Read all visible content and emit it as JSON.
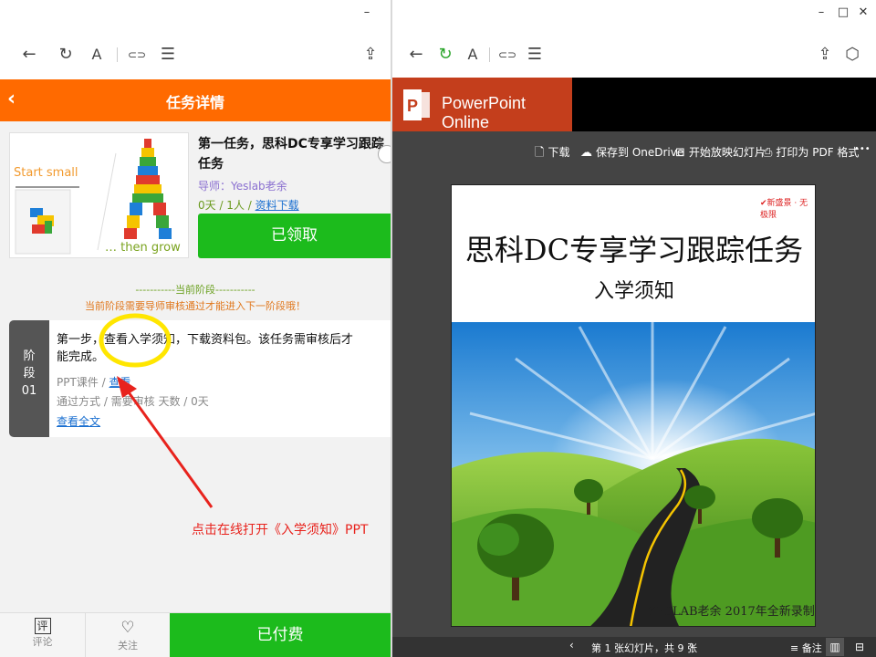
{
  "left_window": {
    "controls": {
      "minimize": "–"
    },
    "toolbar": {
      "back": "←",
      "refresh": "↻",
      "font": "A",
      "link": "⊂⊃",
      "reader": "☰",
      "share": "⇪"
    },
    "header": {
      "back": "‹",
      "title": "任务详情"
    },
    "course": {
      "thumb_top_text": "Start small",
      "thumb_bottom_text": "… then grow",
      "title": "第一任务，思科DC专享学习跟踪任务",
      "mentor": "导师：Yeslab老余",
      "meta_prefix": "0天 / 1人 / ",
      "meta_link": "资料下载",
      "claim_button": "已领取"
    },
    "stage": {
      "current_label": "-----------当前阶段-----------",
      "notice": "当前阶段需要导师审核通过才能进入下一阶段哦！",
      "tab_line1": "阶",
      "tab_line2": "段",
      "tab_line3": "01",
      "description": "第一步，查看入学须知，下载资料包。该任务需审核后才能完成。",
      "type_prefix": "PPT课件 / ",
      "type_link": "查看",
      "pass_info": "通过方式 / 需要审核   天数 / 0天",
      "view_full": "查看全文"
    },
    "annotation": "点击在线打开《入学须知》PPT",
    "bottom_bar": {
      "comment_icon": "评",
      "comment": "评论",
      "follow_icon": "♡",
      "follow": "关注",
      "paid_button": "已付费"
    }
  },
  "right_window": {
    "controls": {
      "minimize": "–",
      "maximize": "□",
      "close": "✕"
    },
    "toolbar": {
      "back": "←",
      "refresh": "↻",
      "font": "A",
      "link": "⊂⊃",
      "reader": "☰",
      "share": "⇪",
      "cube": "⬡"
    },
    "brand": "PowerPoint Online",
    "brand_letter": "P",
    "commands": [
      {
        "icon": "🗋",
        "label": "下载"
      },
      {
        "icon": "☁",
        "label": "保存到 OneDrive"
      },
      {
        "icon": "⊟",
        "label": "开始放映幻灯片"
      },
      {
        "icon": "⎙",
        "label": "打印为 PDF 格式"
      }
    ],
    "more": "•••",
    "slide": {
      "logo": "✔新盛景 · 无极限",
      "title": "思科DC专享学习跟踪任务",
      "subtitle": "入学须知",
      "footer": "YESLAB老余 2017年全新录制"
    },
    "status": {
      "prev": "‹",
      "next": "›",
      "pager": "第 1 张幻灯片，共 9 张",
      "notes": "≡ 备注",
      "reading_view": "▥",
      "slideshow_view": "⊟"
    }
  }
}
